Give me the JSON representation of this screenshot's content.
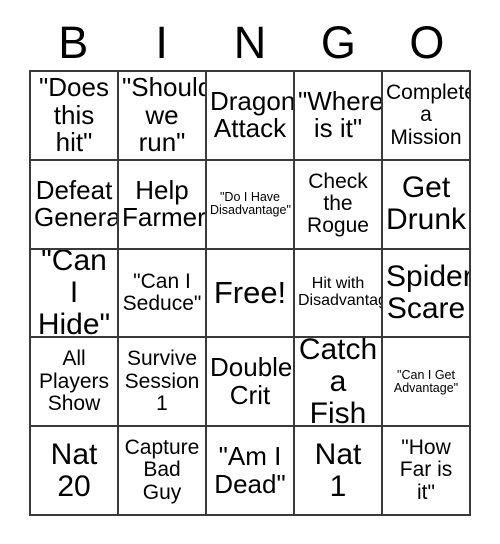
{
  "card": {
    "header_letters": [
      "B",
      "I",
      "N",
      "G",
      "O"
    ],
    "columns": 5,
    "rows": 5,
    "colors": {
      "background": "#ffffff",
      "text": "#000000",
      "grid_line": "#3a3a3a"
    },
    "squares": [
      {
        "text": "\"Does\nthis hit\"",
        "size": "lg",
        "row": 1,
        "col": 1,
        "column_letter": "B"
      },
      {
        "text": "\"Should\nwe run\"",
        "size": "lg",
        "row": 1,
        "col": 2,
        "column_letter": "I"
      },
      {
        "text": "Dragon\nAttack",
        "size": "lg",
        "row": 1,
        "col": 3,
        "column_letter": "N"
      },
      {
        "text": "\"Where\nis it\"",
        "size": "lg",
        "row": 1,
        "col": 4,
        "column_letter": "G"
      },
      {
        "text": "Complete\na Mission",
        "size": "md",
        "row": 1,
        "col": 5,
        "column_letter": "O"
      },
      {
        "text": "Defeat\nGeneral",
        "size": "lg",
        "row": 2,
        "col": 1,
        "column_letter": "B"
      },
      {
        "text": "Help\nFarmers",
        "size": "lg",
        "row": 2,
        "col": 2,
        "column_letter": "I"
      },
      {
        "text": "\"Do I Have\nDisadvantage\"",
        "size": "xs",
        "row": 2,
        "col": 3,
        "column_letter": "N"
      },
      {
        "text": "Check\nthe\nRogue",
        "size": "md",
        "row": 2,
        "col": 4,
        "column_letter": "G"
      },
      {
        "text": "Get\nDrunk",
        "size": "xl",
        "row": 2,
        "col": 5,
        "column_letter": "O"
      },
      {
        "text": "\"Can I\nHide\"",
        "size": "xl",
        "row": 3,
        "col": 1,
        "column_letter": "B"
      },
      {
        "text": "\"Can I\nSeduce\"",
        "size": "md",
        "row": 3,
        "col": 2,
        "column_letter": "I"
      },
      {
        "text": "Free!",
        "size": "free",
        "row": 3,
        "col": 3,
        "column_letter": "N",
        "is_free_space": true
      },
      {
        "text": "Hit with\nDisadvantage",
        "size": "sm",
        "row": 3,
        "col": 4,
        "column_letter": "G"
      },
      {
        "text": "Spider\nScare",
        "size": "xl",
        "row": 3,
        "col": 5,
        "column_letter": "O"
      },
      {
        "text": "All\nPlayers\nShow",
        "size": "md",
        "row": 4,
        "col": 1,
        "column_letter": "B"
      },
      {
        "text": "Survive\nSession\n1",
        "size": "md",
        "row": 4,
        "col": 2,
        "column_letter": "I"
      },
      {
        "text": "Double\nCrit",
        "size": "lg",
        "row": 4,
        "col": 3,
        "column_letter": "N"
      },
      {
        "text": "Catch\na Fish",
        "size": "xl",
        "row": 4,
        "col": 4,
        "column_letter": "G"
      },
      {
        "text": "\"Can I Get\nAdvantage\"",
        "size": "xs",
        "row": 4,
        "col": 5,
        "column_letter": "O"
      },
      {
        "text": "Nat\n20",
        "size": "xl",
        "row": 5,
        "col": 1,
        "column_letter": "B"
      },
      {
        "text": "Capture\nBad\nGuy",
        "size": "md",
        "row": 5,
        "col": 2,
        "column_letter": "I"
      },
      {
        "text": "\"Am I\nDead\"",
        "size": "lg",
        "row": 5,
        "col": 3,
        "column_letter": "N"
      },
      {
        "text": "Nat\n1",
        "size": "xl",
        "row": 5,
        "col": 4,
        "column_letter": "G"
      },
      {
        "text": "\"How\nFar is\nit\"",
        "size": "md",
        "row": 5,
        "col": 5,
        "column_letter": "O"
      }
    ]
  }
}
